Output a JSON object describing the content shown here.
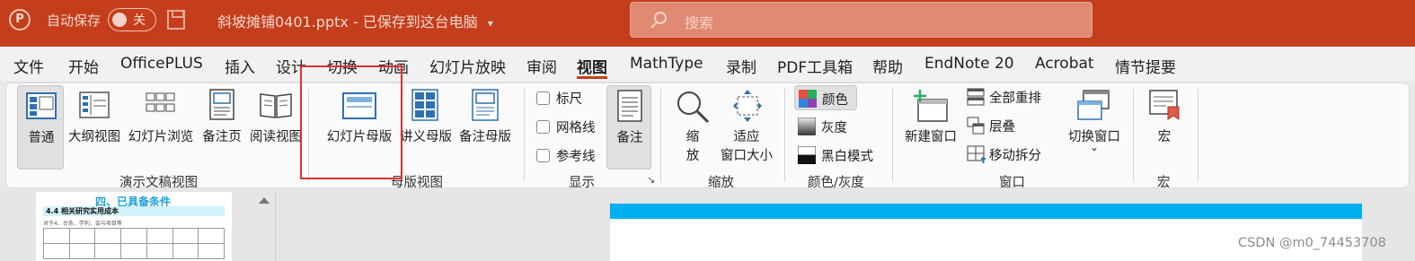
{
  "titlebar": {
    "logo": "P",
    "autosave_label": "自动保存",
    "toggle_state": "关",
    "doc_title": "斜坡摊铺0401.pptx - 已保存到这台电脑",
    "doc_title_caret": "▾",
    "search_placeholder": "搜索",
    "bg_color": "#c43e1c"
  },
  "menu": {
    "tabs": [
      "文件",
      "开始",
      "OfficePLUS",
      "插入",
      "设计",
      "切换",
      "动画",
      "幻灯片放映",
      "审阅",
      "视图",
      "MathType",
      "录制",
      "PDF工具箱",
      "帮助",
      "EndNote 20",
      "Acrobat",
      "情节提要"
    ],
    "active": "视图"
  },
  "ribbon": {
    "presentation_views": {
      "group_label": "演示文稿视图",
      "normal": "普通",
      "outline": "大纲视图",
      "sorter": "幻灯片浏览",
      "notes_page": "备注页",
      "reading": "阅读视图"
    },
    "master_views": {
      "group_label": "母版视图",
      "slide_master": "幻灯片母版",
      "handout_master": "讲义母版",
      "notes_master": "备注母版"
    },
    "show": {
      "group_label": "显示",
      "ruler": "标尺",
      "gridlines": "网格线",
      "guides": "参考线",
      "notes": "备注",
      "launcher": "↘"
    },
    "zoom": {
      "group_label": "缩放",
      "zoom_line1": "缩",
      "zoom_line2": "放",
      "fit_line1": "适应",
      "fit_line2": "窗口大小"
    },
    "color": {
      "group_label": "颜色/灰度",
      "color": "颜色",
      "grayscale": "灰度",
      "bw": "黑白模式"
    },
    "window": {
      "group_label": "窗口",
      "new_window": "新建窗口",
      "arrange_all": "全部重排",
      "cascade": "层叠",
      "move_split": "移动拆分",
      "switch_windows": "切换窗口",
      "switch_caret": "⌄"
    },
    "macros": {
      "group_label": "宏",
      "macro": "宏"
    }
  },
  "thumbnail": {
    "heading": "四、已具备条件",
    "band": "4.4 相关研究实用成本",
    "line": "对于4、台条、学利、会与项目等"
  },
  "watermark": "CSDN @m0_74453708"
}
